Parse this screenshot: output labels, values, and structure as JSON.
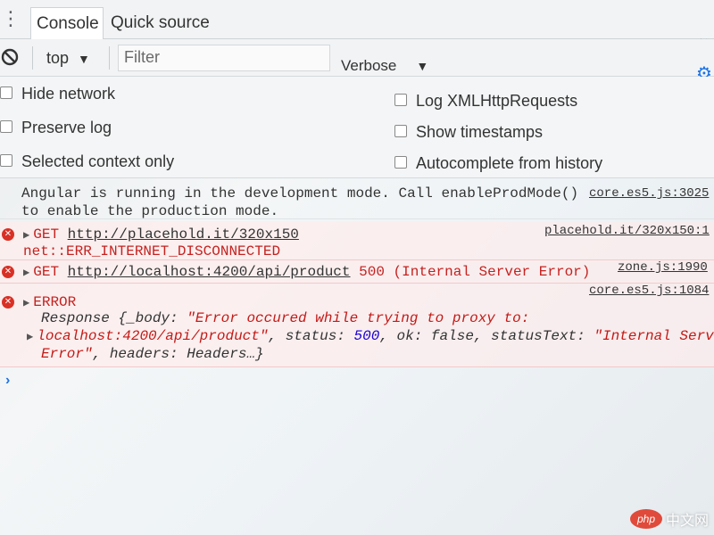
{
  "tabs": {
    "menu_icon": "kebab-icon",
    "console": "Console",
    "quick_source": "Quick source",
    "close": "×"
  },
  "toolbar": {
    "context": "top",
    "filter_placeholder": "Filter",
    "level": "Verbose"
  },
  "settings": {
    "left": [
      "Hide network",
      "Preserve log",
      "Selected context only"
    ],
    "right": [
      "Log XMLHttpRequests",
      "Show timestamps",
      "Autocomplete from history"
    ]
  },
  "messages": {
    "info": {
      "line1": "Angular is running in the development mode. Call enableProdMode()",
      "line2": "to enable the production mode.",
      "source": "core.es5.js:3025"
    },
    "err1": {
      "method": "GET",
      "url": "http://placehold.it/320x150",
      "detail": "net::ERR_INTERNET_DISCONNECTED",
      "source": "placehold.it/320x150:1"
    },
    "err2": {
      "method": "GET",
      "url": "http://localhost:4200/api/product",
      "status": "500 (Internal Server Error)",
      "source": "zone.js:1990"
    },
    "err3": {
      "title": "ERROR",
      "source": "core.es5.js:1084",
      "line1_a": "Response {_body: ",
      "line1_b": "\"Error occured while trying to proxy to:",
      "line2_a": "localhost:4200/api/product\"",
      "line2_b": ", status: ",
      "line2_c": "500",
      "line2_d": ", ok: false, statusText: ",
      "line2_e": "\"Internal Server",
      "line3_a": "Error\"",
      "line3_b": ", headers: Headers…}"
    }
  },
  "prompt": "›",
  "watermark": {
    "badge": "php",
    "text": "中文网"
  },
  "colors": {
    "error": "#c5221f",
    "accent": "#1a73e8"
  }
}
